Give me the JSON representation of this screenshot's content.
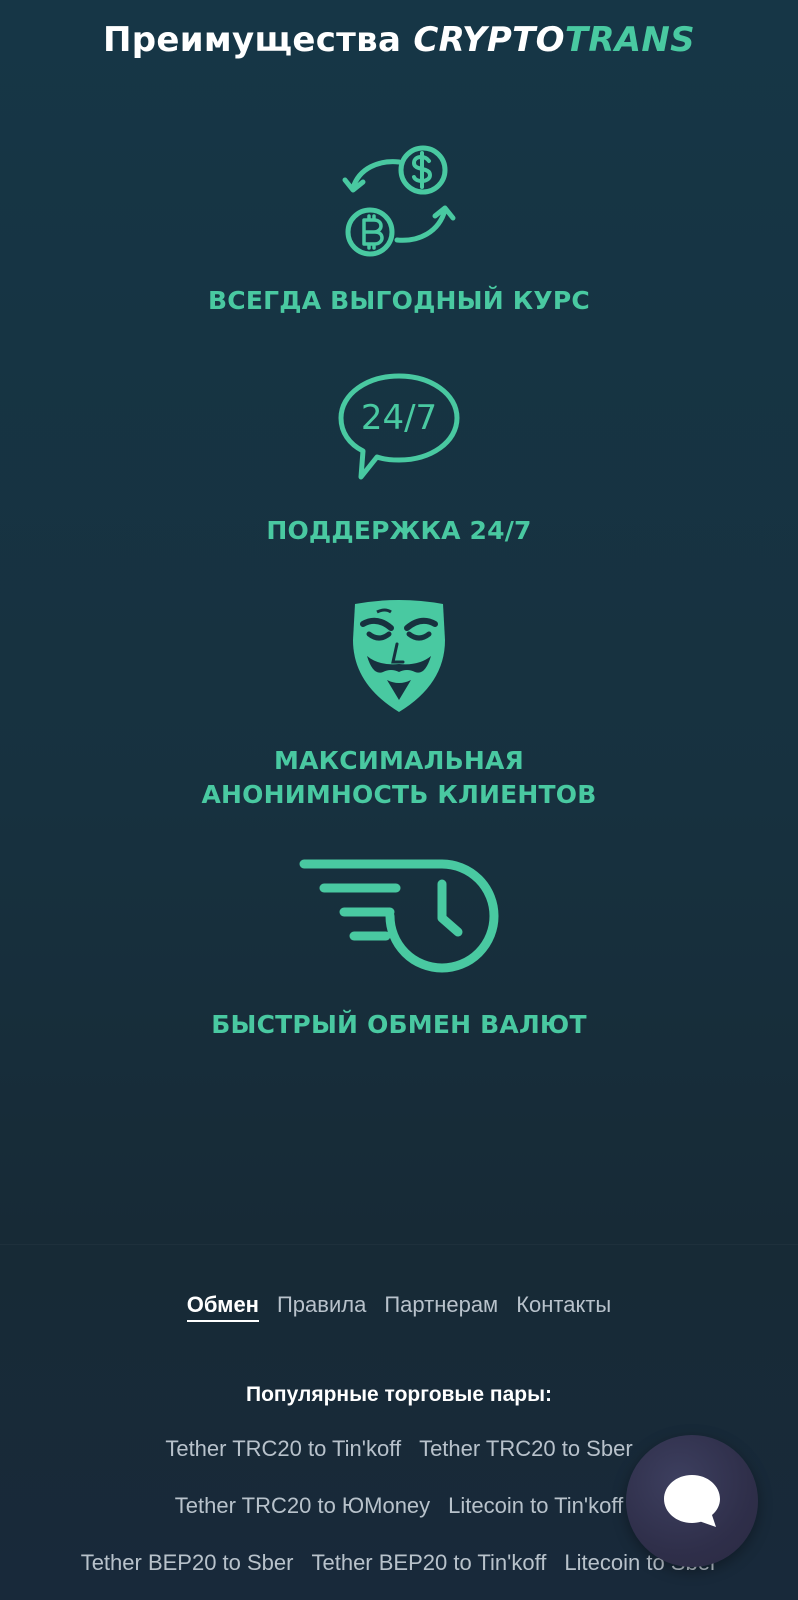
{
  "header": {
    "title_prefix": "Преимущества",
    "brand_part1": "CRYPTO",
    "brand_part2": "TRANS"
  },
  "features": [
    {
      "icon": "currency-exchange-icon",
      "title": "ВСЕГДА ВЫГОДНЫЙ КУРС"
    },
    {
      "icon": "support-chat-icon",
      "icon_text": "24/7",
      "title": "ПОДДЕРЖКА 24/7"
    },
    {
      "icon": "anonymous-mask-icon",
      "title_line1": "МАКСИМАЛЬНАЯ",
      "title_line2": "АНОНИМНОСТЬ КЛИЕНТОВ"
    },
    {
      "icon": "fast-clock-icon",
      "title": "БЫСТРЫЙ ОБМЕН ВАЛЮТ"
    }
  ],
  "footer": {
    "nav": [
      {
        "label": "Обмен",
        "active": true
      },
      {
        "label": "Правила",
        "active": false
      },
      {
        "label": "Партнерам",
        "active": false
      },
      {
        "label": "Контакты",
        "active": false
      }
    ],
    "pairs_title": "Популярные торговые пары:",
    "pairs": [
      [
        "Tether TRC20 to Tin'koff",
        "Tether TRC20 to Sber"
      ],
      [
        "Tether TRC20 to ЮMoney",
        "Litecoin to Tin'koff"
      ],
      [
        "Tether BEP20 to Sber",
        "Tether BEP20 to Tin'koff",
        "Litecoin to Sber"
      ]
    ]
  },
  "chat_widget": {
    "icon": "chat-bubble-icon"
  },
  "colors": {
    "accent": "#49c9a1",
    "background_top": "#163646",
    "background_bottom": "#18293a",
    "link_text": "#b8c2cb",
    "chat_button": "#2f2f4a"
  }
}
